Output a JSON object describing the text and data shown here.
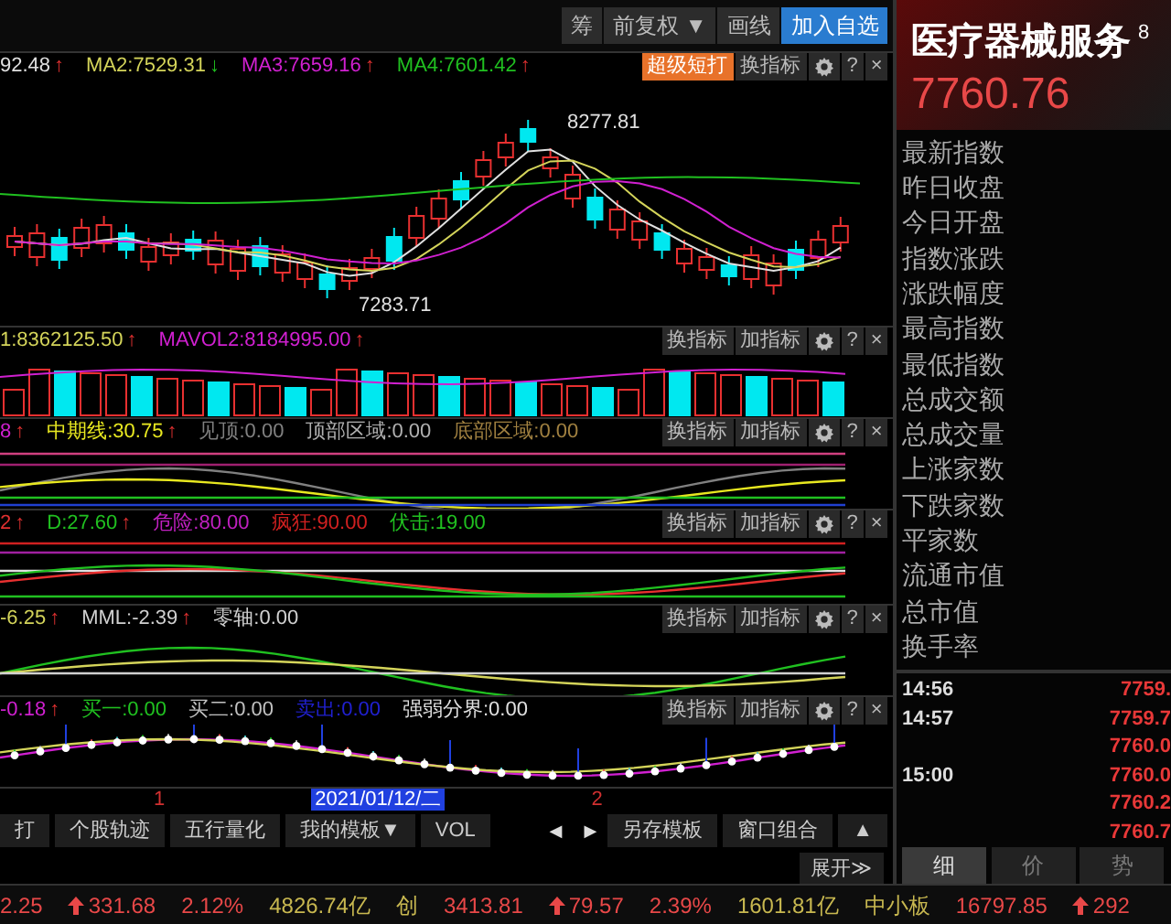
{
  "toolbar": {
    "buttons": [
      {
        "label": "筹",
        "kind": "plain"
      },
      {
        "label": "前复权",
        "kind": "dropdown",
        "caret": "▼"
      },
      {
        "label": "画线",
        "kind": "plain"
      },
      {
        "label": "加入自选",
        "kind": "primary"
      }
    ]
  },
  "panels": [
    {
      "kind": "price",
      "legend": [
        {
          "text": "92.48",
          "arrow": "↑",
          "rising": true,
          "color": "#e0e0e0"
        },
        {
          "text": "MA2:7529.31",
          "arrow": "↓",
          "rising": false,
          "color": "#d4d45a"
        },
        {
          "text": "MA3:7659.16",
          "arrow": "↑",
          "rising": true,
          "color": "#d020d0"
        },
        {
          "text": "MA4:7601.42",
          "arrow": "↑",
          "rising": true,
          "color": "#20c020"
        }
      ],
      "buttons": [
        {
          "label": "超级短打",
          "kind": "accent"
        },
        {
          "label": "换指标",
          "kind": "plain"
        },
        {
          "kind": "gear"
        },
        {
          "label": "?",
          "kind": "plain"
        },
        {
          "label": "×",
          "kind": "plain"
        }
      ],
      "high_label": "8277.81",
      "low_label": "7283.71"
    },
    {
      "kind": "volume",
      "legend": [
        {
          "text": "1:8362125.50",
          "arrow": "↑",
          "rising": true,
          "color": "#d4d45a"
        },
        {
          "text": "MAVOL2:8184995.00",
          "arrow": "↑",
          "rising": true,
          "color": "#d020d0"
        }
      ],
      "buttons": [
        {
          "label": "换指标",
          "kind": "plain"
        },
        {
          "label": "加指标",
          "kind": "plain"
        },
        {
          "kind": "gear"
        },
        {
          "label": "?",
          "kind": "plain"
        },
        {
          "label": "×",
          "kind": "plain"
        }
      ]
    },
    {
      "kind": "trend",
      "legend": [
        {
          "text": "8",
          "arrow": "↑",
          "rising": true,
          "color": "#d020d0"
        },
        {
          "text": "中期线:30.75",
          "arrow": "↑",
          "rising": true,
          "color": "#e8e820"
        },
        {
          "text": "见顶:0.00",
          "color": "#808080"
        },
        {
          "text": "顶部区域:0.00",
          "color": "#b0b0b0"
        },
        {
          "text": "底部区域:0.00",
          "color": "#a08040"
        }
      ],
      "buttons": [
        {
          "label": "换指标",
          "kind": "plain"
        },
        {
          "label": "加指标",
          "kind": "plain"
        },
        {
          "kind": "gear"
        },
        {
          "label": "?",
          "kind": "plain"
        },
        {
          "label": "×",
          "kind": "plain"
        }
      ]
    },
    {
      "kind": "kd",
      "legend": [
        {
          "text": "2",
          "arrow": "↑",
          "rising": true,
          "color": "#e03030"
        },
        {
          "text": "D:27.60",
          "arrow": "↑",
          "rising": true,
          "color": "#20c020"
        },
        {
          "text": "危险:80.00",
          "color": "#c020c0"
        },
        {
          "text": "疯狂:90.00",
          "color": "#d02020"
        },
        {
          "text": "伏击:19.00",
          "color": "#20c020"
        }
      ],
      "buttons": [
        {
          "label": "换指标",
          "kind": "plain"
        },
        {
          "label": "加指标",
          "kind": "plain"
        },
        {
          "kind": "gear"
        },
        {
          "label": "?",
          "kind": "plain"
        },
        {
          "label": "×",
          "kind": "plain"
        }
      ]
    },
    {
      "kind": "macd",
      "legend": [
        {
          "text": "-6.25",
          "arrow": "↑",
          "rising": true,
          "color": "#d4d45a"
        },
        {
          "text": "MML:-2.39",
          "arrow": "↑",
          "rising": true,
          "color": "#d0d0d0"
        },
        {
          "text": "零轴:0.00",
          "color": "#d0d0d0"
        }
      ],
      "buttons": [
        {
          "label": "换指标",
          "kind": "plain"
        },
        {
          "label": "加指标",
          "kind": "plain"
        },
        {
          "kind": "gear"
        },
        {
          "label": "?",
          "kind": "plain"
        },
        {
          "label": "×",
          "kind": "plain"
        }
      ]
    },
    {
      "kind": "signal",
      "legend": [
        {
          "text": "-0.18",
          "arrow": "↑",
          "rising": true,
          "color": "#d020d0"
        },
        {
          "text": "买一:0.00",
          "color": "#20c020"
        },
        {
          "text": "买二:0.00",
          "color": "#c0c0c0"
        },
        {
          "text": "卖出:0.00",
          "color": "#2020d0"
        },
        {
          "text": "强弱分界:0.00",
          "color": "#e0e0e0"
        }
      ],
      "buttons": [
        {
          "label": "换指标",
          "kind": "plain"
        },
        {
          "label": "加指标",
          "kind": "plain"
        },
        {
          "kind": "gear"
        },
        {
          "label": "?",
          "kind": "plain"
        },
        {
          "label": "×",
          "kind": "plain"
        }
      ]
    }
  ],
  "time_axis": {
    "marks": [
      {
        "text": "1",
        "kind": "month"
      },
      {
        "text": "2021/01/12/二",
        "kind": "cursor"
      },
      {
        "text": "2",
        "kind": "month"
      }
    ]
  },
  "bottom_tabs": [
    {
      "label": "打",
      "kind": "tab"
    },
    {
      "label": "个股轨迹",
      "kind": "tab"
    },
    {
      "label": "五行量化",
      "kind": "tab"
    },
    {
      "label": "我的模板▼",
      "kind": "tab"
    },
    {
      "label": "VOL",
      "kind": "tab"
    },
    {
      "label": "◀",
      "kind": "arrow"
    },
    {
      "label": "▶",
      "kind": "arrow"
    },
    {
      "label": "另存模板",
      "kind": "tab"
    },
    {
      "label": "窗口组合",
      "kind": "tab"
    },
    {
      "label": "▲",
      "kind": "tab"
    }
  ],
  "expand_button": {
    "label": "展开≫"
  },
  "quote": {
    "title": "医疗器械服务",
    "code": "8",
    "price": "7760.76",
    "fields": [
      "最新指数",
      "昨日收盘",
      "今日开盘",
      "指数涨跌",
      "涨跌幅度",
      "最高指数",
      "最低指数",
      "总成交额",
      "总成交量",
      "上涨家数",
      "下跌家数",
      "平家数",
      "流通市值",
      "总市值",
      "换手率"
    ],
    "ticks": [
      {
        "time": "14:56",
        "value": "7759."
      },
      {
        "time": "14:57",
        "value": "7759.7"
      },
      {
        "value": "7760.0"
      },
      {
        "time": "15:00",
        "value": "7760.0"
      },
      {
        "value": "7760.2"
      },
      {
        "value": "7760.7"
      }
    ],
    "tabs": [
      {
        "label": "细",
        "selected": true
      },
      {
        "label": "价",
        "selected": false
      },
      {
        "label": "势",
        "selected": false
      }
    ]
  },
  "status_bar": [
    {
      "text": "2.25",
      "kind": "red"
    },
    {
      "text": "331.68",
      "kind": "red",
      "rising": true
    },
    {
      "text": "2.12%",
      "kind": "red"
    },
    {
      "text": "4826.74亿",
      "kind": "yellow"
    },
    {
      "text": "创",
      "kind": "yellow"
    },
    {
      "text": "3413.81",
      "kind": "red"
    },
    {
      "text": "79.57",
      "kind": "red",
      "rising": true
    },
    {
      "text": "2.39%",
      "kind": "red"
    },
    {
      "text": "1601.81亿",
      "kind": "yellow"
    },
    {
      "text": "中小板",
      "kind": "yellow"
    },
    {
      "text": "16797.85",
      "kind": "red"
    },
    {
      "text": "292",
      "kind": "red",
      "rising": true
    }
  ]
}
